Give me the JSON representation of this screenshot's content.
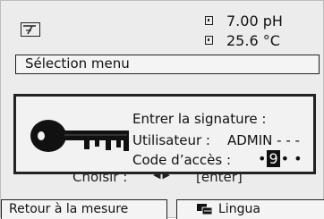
{
  "status": {
    "mode_icon": "measurement-mode-icon",
    "readings": [
      {
        "value": "7.00 pH"
      },
      {
        "value": "25.6 °C"
      }
    ]
  },
  "menu": {
    "title": "Sélection menu"
  },
  "hint": {
    "choose_label": "Choisir :",
    "enter_label": "[enter]"
  },
  "dialog": {
    "prompt": "Entrer la signature :",
    "user_label": "Utilisateur :",
    "user_value": "ADMIN - - -",
    "code_label": "Code d’accès :",
    "code_before": "•",
    "code_cursor": "9",
    "code_after": "• •",
    "icon": "key-icon"
  },
  "softkeys": {
    "left": "Retour à la mesure",
    "right": "Lingua",
    "right_icon": "language-flags-icon"
  }
}
